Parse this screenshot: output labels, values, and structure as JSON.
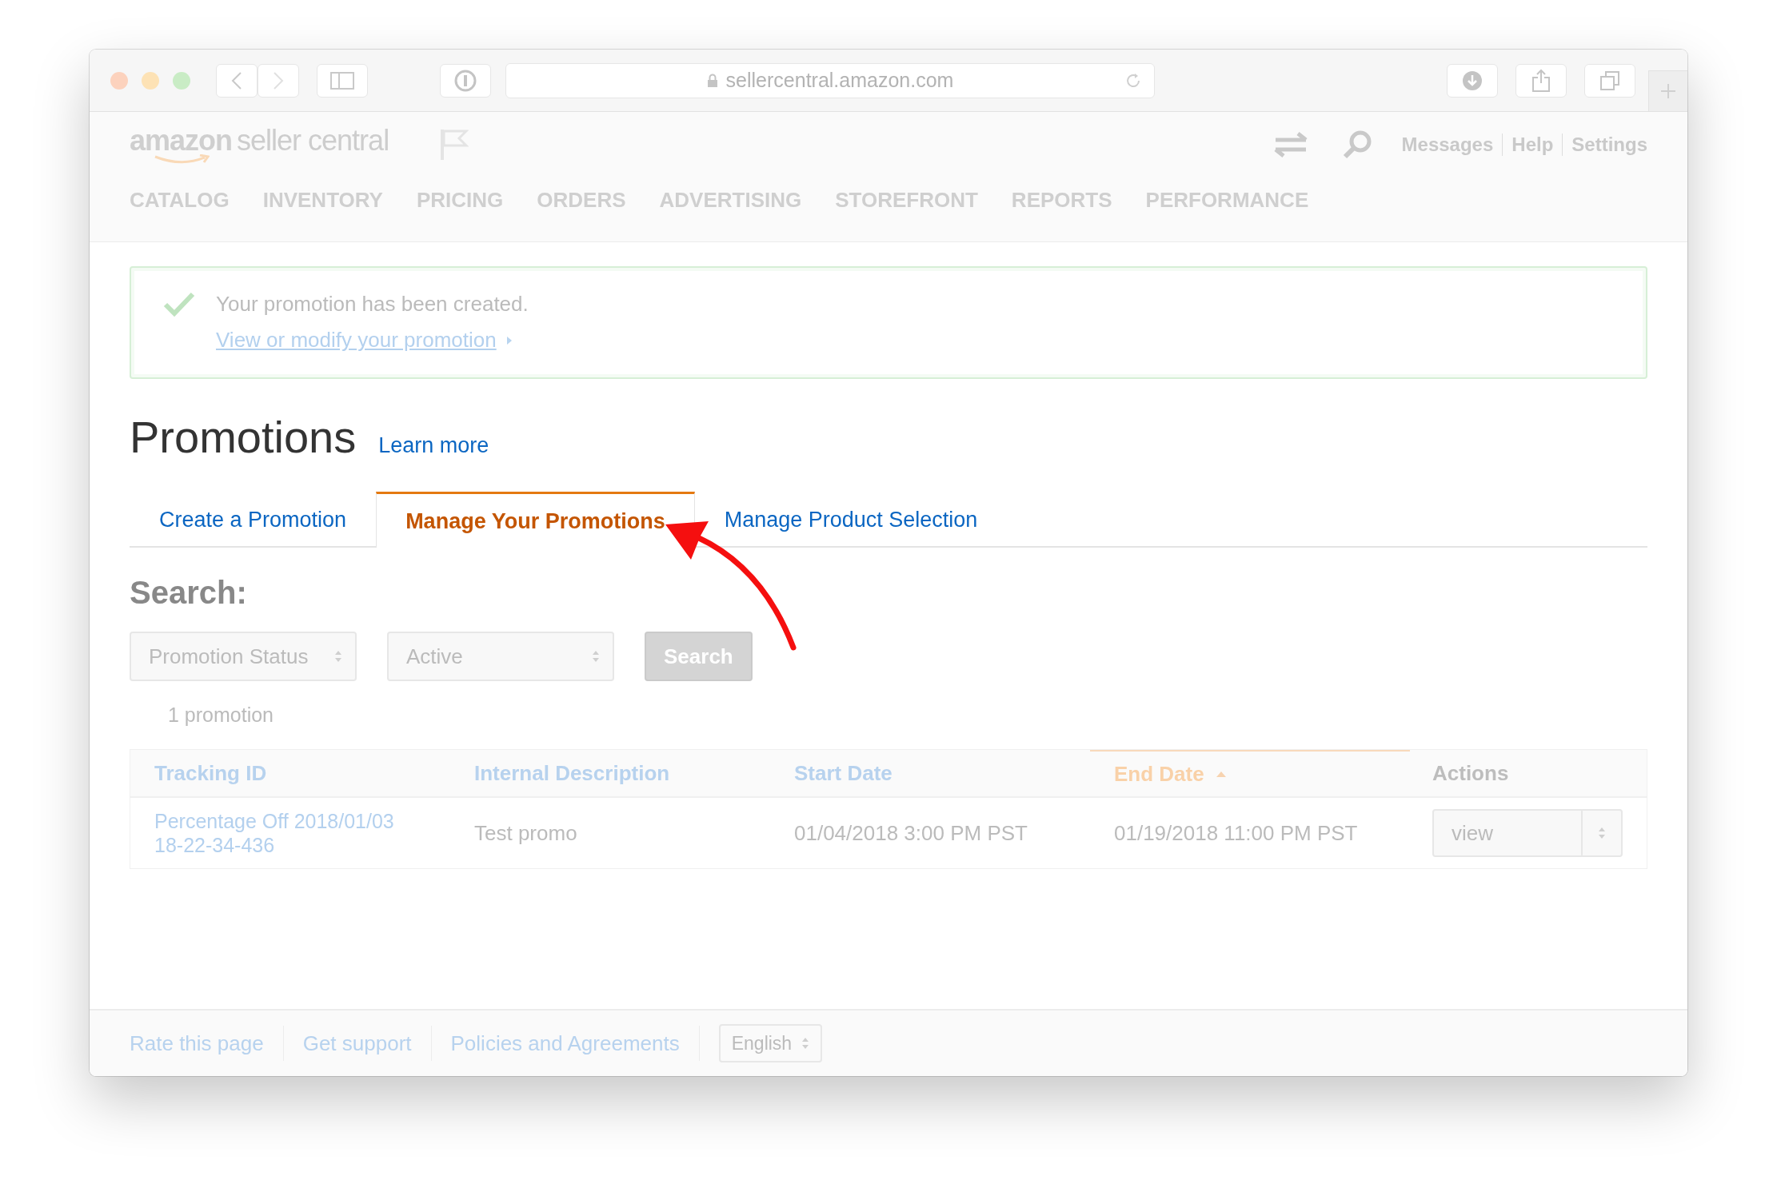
{
  "browser": {
    "url": "sellercentral.amazon.com"
  },
  "header": {
    "logo": {
      "brand": "amazon",
      "product": "seller central"
    },
    "links": [
      "Messages",
      "Help",
      "Settings"
    ],
    "nav": [
      "CATALOG",
      "INVENTORY",
      "PRICING",
      "ORDERS",
      "ADVERTISING",
      "STOREFRONT",
      "REPORTS",
      "PERFORMANCE"
    ]
  },
  "banner": {
    "message": "Your promotion has been created.",
    "link": "View or modify your promotion"
  },
  "page": {
    "title": "Promotions",
    "learn_more": "Learn more"
  },
  "tabs": [
    {
      "label": "Create a Promotion",
      "selected": false
    },
    {
      "label": "Manage Your Promotions",
      "selected": true
    },
    {
      "label": "Manage Product Selection",
      "selected": false
    }
  ],
  "search": {
    "heading": "Search:",
    "filters": [
      {
        "value": "Promotion Status"
      },
      {
        "value": "Active"
      }
    ],
    "button": "Search",
    "count": "1 promotion"
  },
  "table": {
    "columns": [
      {
        "label": "Tracking ID",
        "kind": "link"
      },
      {
        "label": "Internal Description",
        "kind": "link"
      },
      {
        "label": "Start Date",
        "kind": "link"
      },
      {
        "label": "End Date",
        "kind": "sorted"
      },
      {
        "label": "Actions",
        "kind": "plain"
      }
    ],
    "rows": [
      {
        "cells": [
          "Percentage Off 2018/01/03 18-22-34-436",
          "Test promo",
          "01/04/2018 3:00 PM PST",
          "01/19/2018 11:00 PM PST"
        ],
        "action": "view"
      }
    ]
  },
  "footer": {
    "links": [
      "Rate this page",
      "Get support",
      "Policies and Agreements"
    ],
    "language": "English"
  }
}
